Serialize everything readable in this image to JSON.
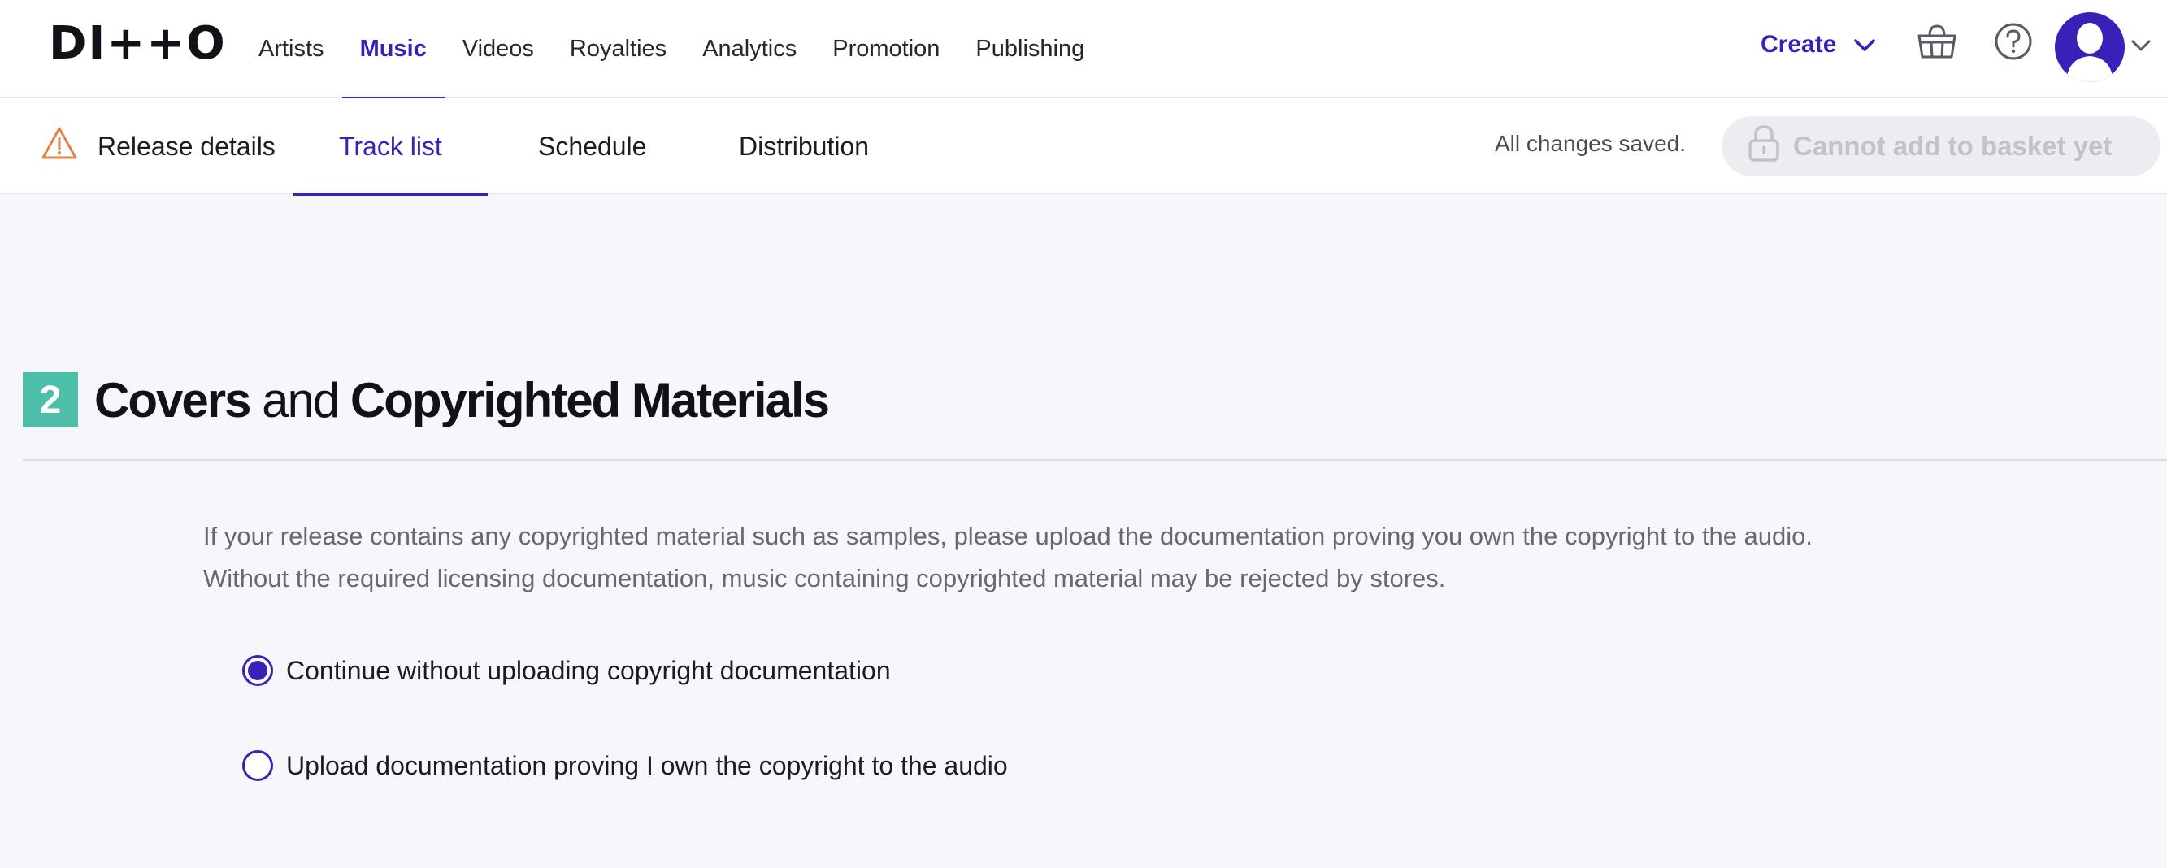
{
  "brand": {
    "logo_text": "DI++O",
    "accent": "#3a1fb8",
    "step_color": "#4dbfa8"
  },
  "nav": {
    "items": [
      {
        "label": "Artists",
        "active": false
      },
      {
        "label": "Music",
        "active": true
      },
      {
        "label": "Videos",
        "active": false
      },
      {
        "label": "Royalties",
        "active": false
      },
      {
        "label": "Analytics",
        "active": false
      },
      {
        "label": "Promotion",
        "active": false
      },
      {
        "label": "Publishing",
        "active": false
      }
    ],
    "create_label": "Create",
    "icons": [
      "basket-icon",
      "help-icon",
      "avatar",
      "chevron-down-icon"
    ]
  },
  "tabs": {
    "release_details": "Release details",
    "track_list": "Track list",
    "schedule": "Schedule",
    "distribution": "Distribution",
    "active": "Track list",
    "release_details_status": "warning"
  },
  "status": {
    "saved_text": "All changes saved.",
    "basket_button_label": "Cannot add to basket yet",
    "basket_button_disabled": true
  },
  "section": {
    "step": "2",
    "title_part1": "Covers",
    "title_part2": " and ",
    "title_part3": "Copyrighted Materials",
    "description_line1": "If your release contains any copyrighted material such as samples, please upload the documentation proving you own the copyright to the audio.",
    "description_line2": "Without the required licensing documentation, music containing copyrighted material may be rejected by stores.",
    "options": [
      {
        "label": "Continue without uploading copyright documentation",
        "selected": true
      },
      {
        "label": "Upload documentation proving I own the copyright to the audio",
        "selected": false
      }
    ]
  }
}
